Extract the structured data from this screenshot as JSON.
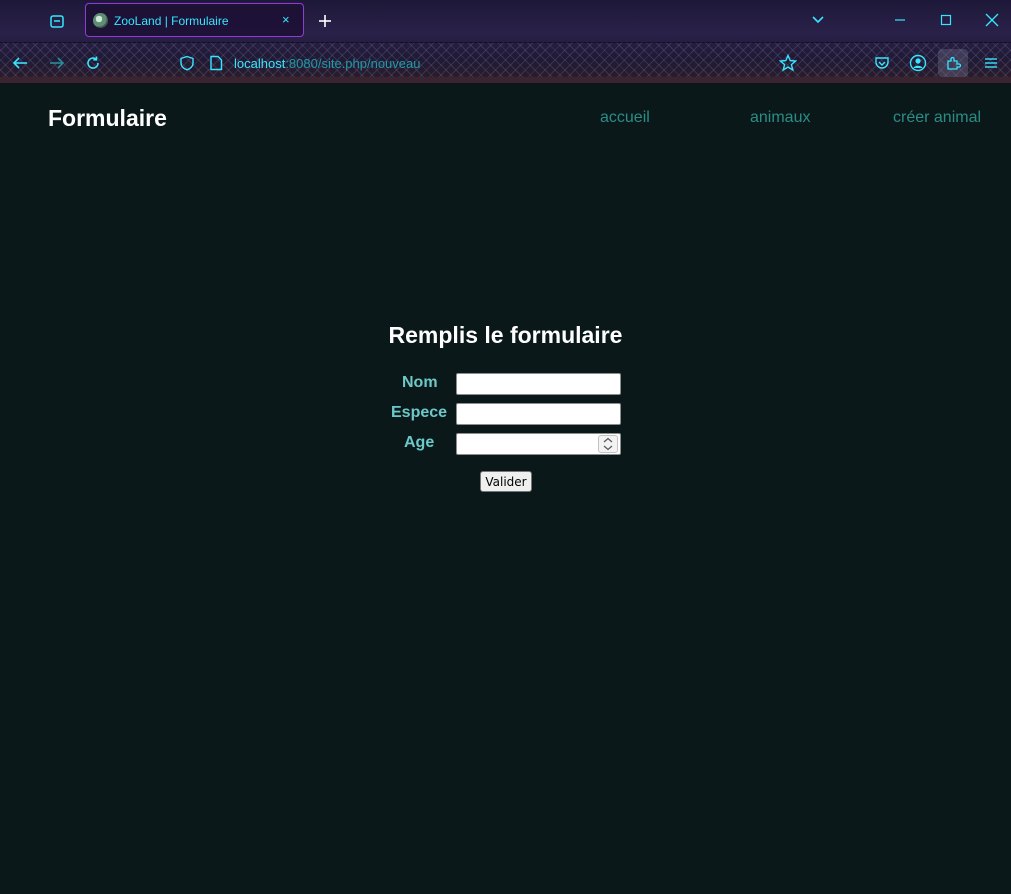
{
  "browser": {
    "tab": {
      "title": "ZooLand | Formulaire",
      "close": "×"
    },
    "url": {
      "host": "localhost",
      "path": ":8080/site.php/nouveau"
    },
    "icons": [
      "tab-overview-icon",
      "new-tab-icon",
      "list-tabs-icon",
      "minimize-icon",
      "maximize-icon",
      "close-window-icon",
      "back-icon",
      "forward-icon",
      "reload-icon",
      "shield-icon",
      "page-icon",
      "star-icon",
      "pocket-icon",
      "account-icon",
      "extensions-icon",
      "menu-icon"
    ],
    "accent": "#35e6ff"
  },
  "header": {
    "title": "Formulaire",
    "nav": {
      "accueil": "accueil",
      "animaux": "animaux",
      "creer": "créer animal"
    }
  },
  "form": {
    "title": "Remplis le formulaire",
    "fields": {
      "nom": {
        "label": "Nom",
        "value": ""
      },
      "espece": {
        "label": "Espece",
        "value": ""
      },
      "age": {
        "label": "Age",
        "value": ""
      }
    },
    "submit": "Valider"
  },
  "colors": {
    "background": "#0b1819",
    "heading": "#ffffff",
    "nav_link": "#2a8c86",
    "label": "#6cc9c9"
  }
}
